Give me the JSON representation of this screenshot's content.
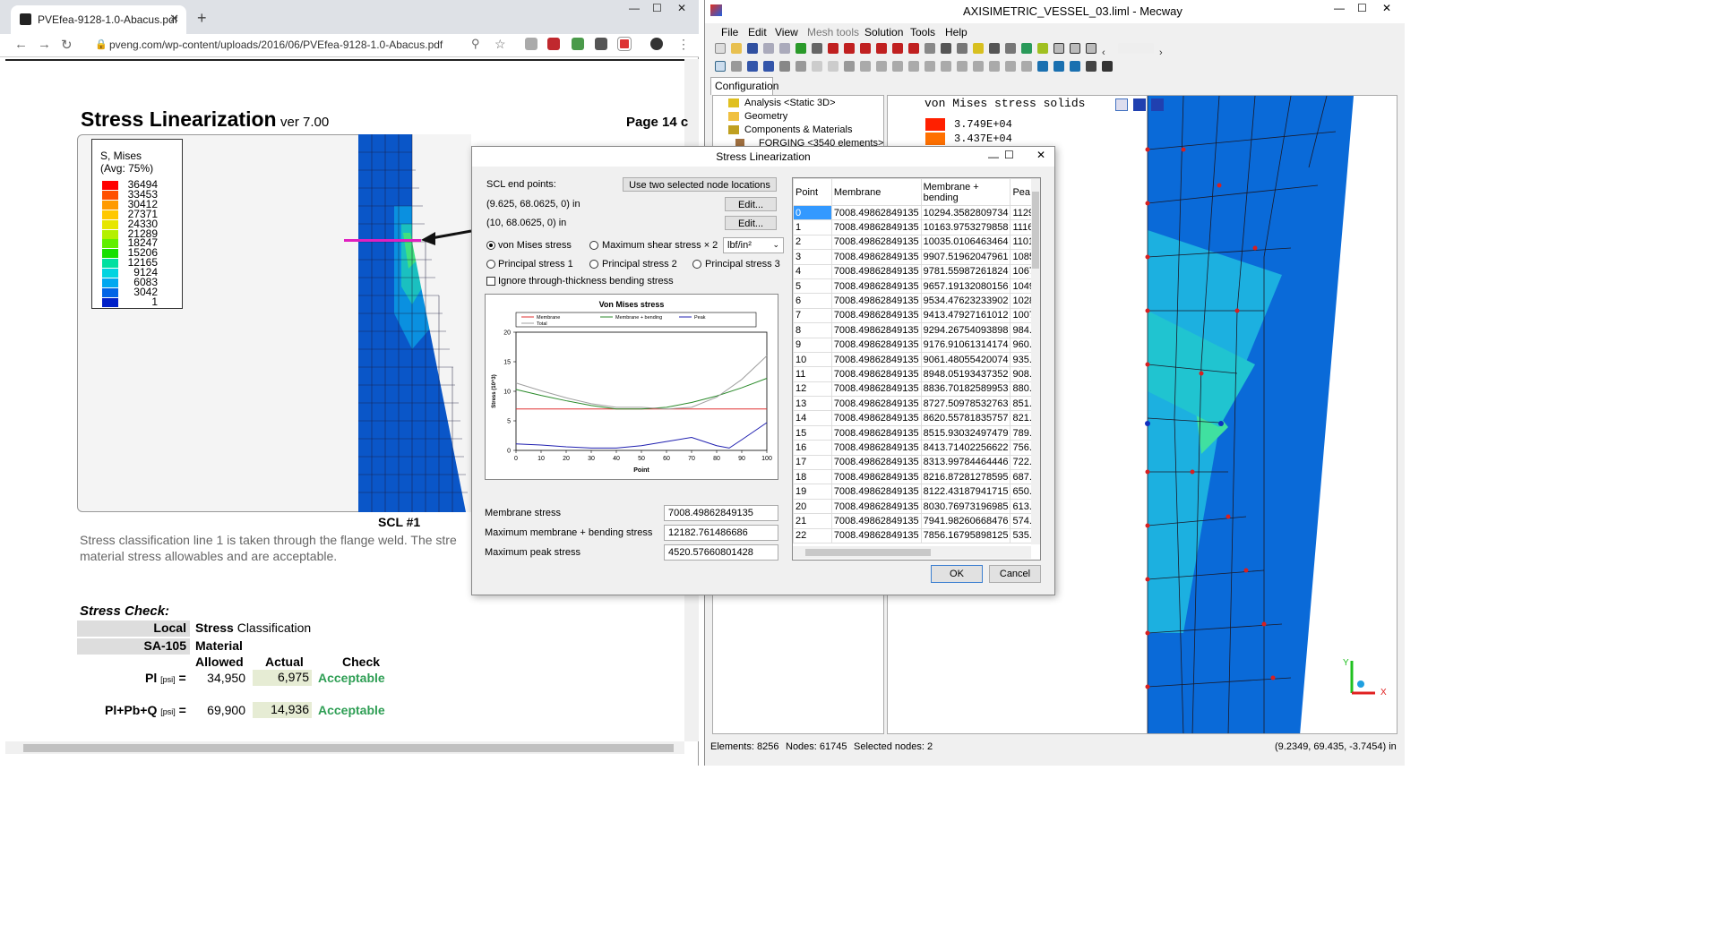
{
  "browser": {
    "tab_title": "PVEfea-9128-1.0-Abacus.pdf",
    "url": "pveng.com/wp-content/uploads/2016/06/PVEfea-9128-1.0-Abacus.pdf",
    "win_min": "—",
    "win_max": "☐",
    "win_close": "✕",
    "tab_close": "✕",
    "new_tab": "+",
    "pdf": {
      "title": "Stress Linearization",
      "version": "ver 7.00",
      "page": "Page 14 c",
      "legend_title_1": "S, Mises",
      "legend_title_2": "(Avg: 75%)",
      "legend_values": [
        "36494",
        "33453",
        "30412",
        "27371",
        "24330",
        "21289",
        "18247",
        "15206",
        "12165",
        "9124",
        "6083",
        "3042",
        "1"
      ],
      "legend_colors": [
        "#ff0000",
        "#ff5000",
        "#ff9a00",
        "#ffc800",
        "#e6e600",
        "#b4f000",
        "#60ef00",
        "#16e000",
        "#00e0a0",
        "#00d4e0",
        "#00a8f0",
        "#0064e6",
        "#0020c8"
      ],
      "scl_label": "SCL #1",
      "paragraph": "Stress classification line 1 is taken through the flange weld.  The stre\nmaterial stress allowables and are acceptable.",
      "stress_check": "Stress Check:",
      "row1_left": "Local",
      "row1_right": "Stress Classification",
      "row1_right_bold": "Stress",
      "row1_right_rest": " Classification",
      "row2_left": "SA-105",
      "row2_right": "Material",
      "col_allowed": "Allowed",
      "col_actual": "Actual",
      "col_check": "Check",
      "pl_label": "Pl",
      "pl_unit": "[psi]",
      "pl_eq": "=",
      "pl_allowed": "34,950",
      "pl_actual": "6,975",
      "pl_check": "Acceptable",
      "plpb_label": "Pl+Pb+Q",
      "plpb_unit": "[psi]",
      "plpb_eq": "=",
      "plpb_allowed": "69,900",
      "plpb_actual": "14,936",
      "plpb_check": "Acceptable"
    }
  },
  "mecway": {
    "title": "AXISIMETRIC_VESSEL_03.liml - Mecway",
    "menu": [
      "File",
      "Edit",
      "View",
      "Mesh tools",
      "Solution",
      "Tools",
      "Help"
    ],
    "config_tab": "Configuration",
    "tree": [
      "Analysis <Static 3D>",
      "Geometry",
      "Components & Materials",
      "FORGING <3540 elements>"
    ],
    "view_title": "von Mises stress solids",
    "view_values": [
      "3.749E+04",
      "3.437E+04",
      "3.124E+04"
    ],
    "view_colors": [
      "#ff2000",
      "#ff7000",
      "#ffa000"
    ],
    "status": {
      "elements": "Elements: 8256",
      "nodes": "Nodes: 61745",
      "selected": "Selected nodes: 2",
      "coords": "(9.2349, 69.435, -3.7454) in"
    },
    "axis_x": "X",
    "axis_y": "Y"
  },
  "dialog": {
    "title": "Stress Linearization",
    "close": "✕",
    "scl_end_points": "SCL end points:",
    "use_two_btn": "Use two selected node locations",
    "point1": "(9.625, 68.0625, 0) in",
    "point2": "(10, 68.0625, 0) in",
    "edit_btn": "Edit...",
    "radio_von_mises": "von Mises stress",
    "radio_max_shear": "Maximum shear stress × 2",
    "unit_select": "lbf/in²",
    "radio_p1": "Principal stress 1",
    "radio_p2": "Principal stress 2",
    "radio_p3": "Principal stress 3",
    "ignore_bending": "Ignore through-thickness bending stress",
    "membrane_label": "Membrane stress",
    "membrane_value": "7008.49862849135",
    "max_mb_label": "Maximum membrane + bending stress",
    "max_mb_value": "12182.761486686",
    "max_peak_label": "Maximum peak stress",
    "max_peak_value": "4520.57660801428",
    "ok": "OK",
    "cancel": "Cancel",
    "grid": {
      "headers": [
        "Point",
        "Membrane",
        "Membrane + bending",
        "Pea"
      ],
      "rows": [
        [
          "0",
          "7008.49862849135",
          "10294.3582809734",
          "1129"
        ],
        [
          "1",
          "7008.49862849135",
          "10163.9753279858",
          "1116"
        ],
        [
          "2",
          "7008.49862849135",
          "10035.0106463464",
          "1101"
        ],
        [
          "3",
          "7008.49862849135",
          "9907.51962047961",
          "1085"
        ],
        [
          "4",
          "7008.49862849135",
          "9781.55987261824",
          "1067"
        ],
        [
          "5",
          "7008.49862849135",
          "9657.19132080156",
          "1049"
        ],
        [
          "6",
          "7008.49862849135",
          "9534.47623233902",
          "1028"
        ],
        [
          "7",
          "7008.49862849135",
          "9413.47927161012",
          "1007"
        ],
        [
          "8",
          "7008.49862849135",
          "9294.26754093898",
          "984.7"
        ],
        [
          "9",
          "7008.49862849135",
          "9176.91061314174",
          "960.0"
        ],
        [
          "10",
          "7008.49862849135",
          "9061.48055420074",
          "935.3"
        ],
        [
          "11",
          "7008.49862849135",
          "8948.05193437352",
          "908.0"
        ],
        [
          "12",
          "7008.49862849135",
          "8836.70182589953",
          "880.7"
        ],
        [
          "13",
          "7008.49862849135",
          "8727.50978532763",
          "851.5"
        ],
        [
          "14",
          "7008.49862849135",
          "8620.55781835757",
          "821.0"
        ],
        [
          "15",
          "7008.49862849135",
          "8515.93032497479",
          "789.3"
        ],
        [
          "16",
          "7008.49862849135",
          "8413.71402256622",
          "756.4"
        ],
        [
          "17",
          "7008.49862849135",
          "8313.99784464446",
          "722.3"
        ],
        [
          "18",
          "7008.49862849135",
          "8216.87281278595",
          "687.0"
        ],
        [
          "19",
          "7008.49862849135",
          "8122.43187941715",
          "650.0"
        ],
        [
          "20",
          "7008.49862849135",
          "8030.76973196985",
          "613."
        ],
        [
          "21",
          "7008.49862849135",
          "7941.98260668476",
          "574.7"
        ],
        [
          "22",
          "7008.49862849135",
          "7856.16795898125",
          "535.4"
        ]
      ]
    }
  },
  "chart_data": {
    "type": "line",
    "title": "Von Mises stress",
    "xlabel": "Point",
    "ylabel": "Stress (10^3)",
    "xlim": [
      0,
      100
    ],
    "ylim": [
      0,
      20
    ],
    "xticks": [
      0,
      10,
      20,
      30,
      40,
      50,
      60,
      70,
      80,
      90,
      100
    ],
    "yticks": [
      0,
      5,
      10,
      15,
      20
    ],
    "legend": [
      "Membrane",
      "Membrane + bending",
      "Peak",
      "Total"
    ],
    "series": [
      {
        "name": "Membrane",
        "color": "#e03030",
        "x": [
          0,
          100
        ],
        "y": [
          7.0,
          7.0
        ]
      },
      {
        "name": "Membrane + bending",
        "color": "#2a8a2a",
        "x": [
          0,
          10,
          20,
          30,
          40,
          50,
          60,
          70,
          80,
          90,
          100
        ],
        "y": [
          10.3,
          9.3,
          8.4,
          7.6,
          7.0,
          7.0,
          7.3,
          8.1,
          9.2,
          10.6,
          12.2
        ]
      },
      {
        "name": "Peak",
        "color": "#2020b0",
        "x": [
          0,
          10,
          20,
          30,
          40,
          50,
          60,
          70,
          80,
          85,
          90,
          100
        ],
        "y": [
          1.1,
          0.9,
          0.6,
          0.4,
          0.4,
          0.8,
          1.5,
          2.2,
          0.8,
          0.4,
          1.8,
          4.7
        ]
      },
      {
        "name": "Total",
        "color": "#a0a0a0",
        "x": [
          0,
          10,
          20,
          30,
          40,
          50,
          60,
          70,
          80,
          90,
          100
        ],
        "y": [
          11.4,
          10.1,
          8.9,
          7.9,
          7.3,
          7.3,
          7.0,
          7.3,
          9.0,
          12.0,
          16.0
        ]
      }
    ]
  }
}
